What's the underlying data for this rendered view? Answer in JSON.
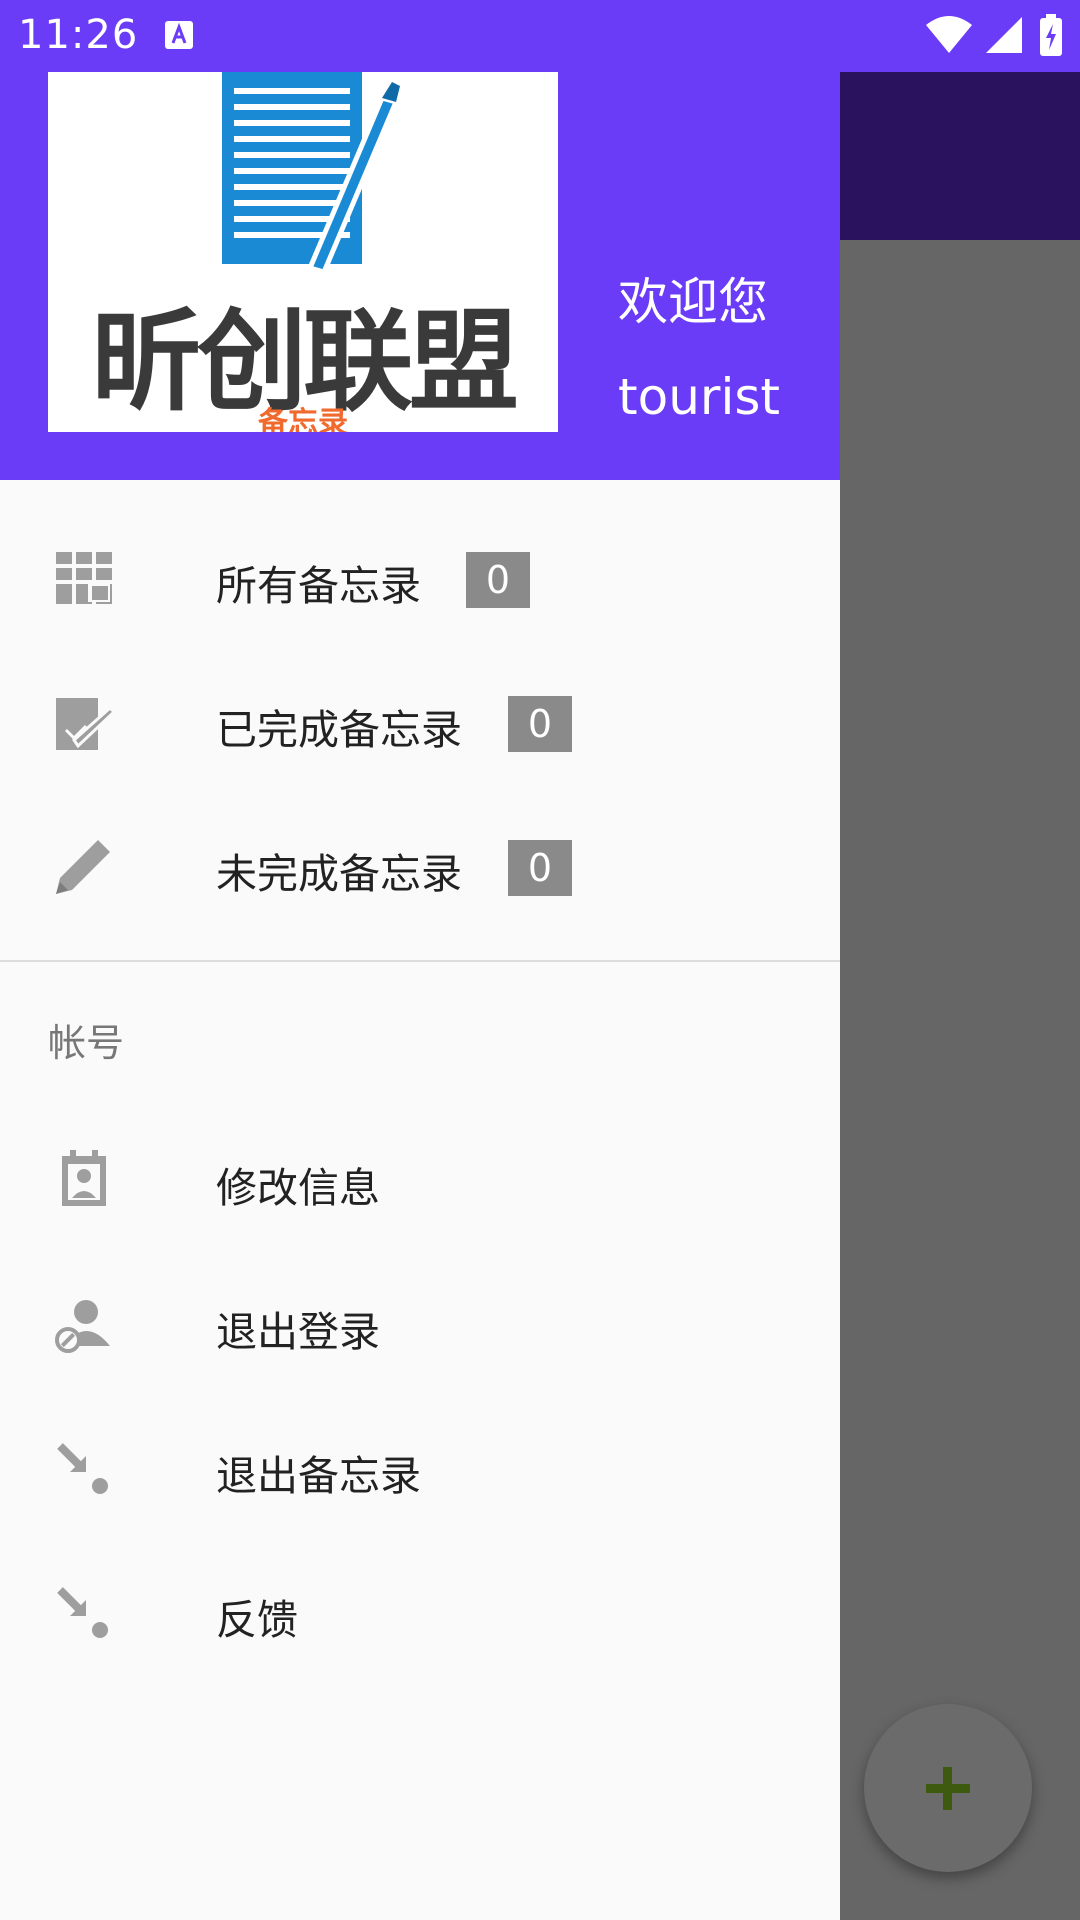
{
  "status_bar": {
    "time": "11:26",
    "icons": [
      "text-a-icon",
      "wifi-icon",
      "signal-icon",
      "battery-charging-icon"
    ]
  },
  "drawer": {
    "logo": {
      "title": "昕创联盟",
      "subtitle": "备忘录"
    },
    "welcome": "欢迎您",
    "username": "tourist",
    "menu": [
      {
        "label": "所有备忘录",
        "count": "0",
        "icon": "calendar-grid-icon"
      },
      {
        "label": "已完成备忘录",
        "count": "0",
        "icon": "edit-check-icon"
      },
      {
        "label": "未完成备忘录",
        "count": "0",
        "icon": "pencil-icon"
      }
    ],
    "account_section": {
      "label": "帐号",
      "items": [
        {
          "label": "修改信息",
          "icon": "contact-card-icon"
        },
        {
          "label": "退出登录",
          "icon": "user-blocked-icon"
        },
        {
          "label": "退出备忘录",
          "icon": "exit-arrow-icon"
        },
        {
          "label": "反馈",
          "icon": "feedback-arrow-icon"
        }
      ]
    }
  },
  "fab": {
    "icon": "plus-icon"
  },
  "colors": {
    "primary": "#6a3cf7",
    "toolbar_dark": "#2b125f",
    "scrim": "#666666",
    "fab_plus": "#3d5a0f"
  }
}
